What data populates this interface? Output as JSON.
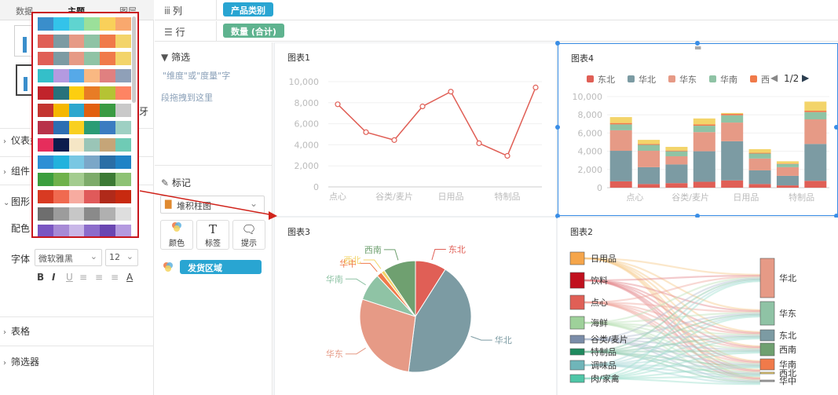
{
  "left_panel": {
    "tabs": [
      "数据",
      "主题",
      "图层"
    ],
    "sections": {
      "dashboard": "仪表盘",
      "component": "组件",
      "graphic": "图形",
      "table": "表格",
      "filter": "筛选器"
    },
    "color_label": "配色",
    "font_label": "字体",
    "font_value": "微软雅黑",
    "size_value": "12",
    "partial_char": "牙",
    "format_buttons": [
      "B",
      "I",
      "U",
      "≡",
      "≡",
      "≡",
      "A"
    ]
  },
  "palettes": [
    [
      "#3a8ecb",
      "#33c3ea",
      "#5fd4d0",
      "#9be09a",
      "#f9d05a",
      "#f9a86e"
    ],
    [
      "#e05f56",
      "#7c9ba3",
      "#e69a86",
      "#8fc3a5",
      "#f07a4a",
      "#f3d46a"
    ],
    [
      "#e05f56",
      "#7c9ba3",
      "#e69a86",
      "#8fc3a5",
      "#f07a4a",
      "#f3d46a"
    ],
    [
      "#34bfc9",
      "#b49ae0",
      "#56a9e8",
      "#f9b882",
      "#e08080",
      "#8fa0b8"
    ],
    [
      "#c1232b",
      "#27727b",
      "#fcce10",
      "#e87c25",
      "#b5c334",
      "#fe8463"
    ],
    [
      "#c33530",
      "#f5b700",
      "#2da7ce",
      "#e2600f",
      "#3a9b43",
      "#c9c9c9"
    ],
    [
      "#b8324a",
      "#2d6eb2",
      "#f9d020",
      "#2a9c75",
      "#3b7cc1",
      "#9ed0c3"
    ],
    [
      "#e62d5c",
      "#0d1c4d",
      "#f5e6c5",
      "#9ac5b7",
      "#c5a578",
      "#6fcbb5"
    ],
    [
      "#2d8fd5",
      "#23b2dd",
      "#79c7e3",
      "#7ba7c8",
      "#2a6ea6",
      "#1f83c6"
    ],
    [
      "#3b9e3e",
      "#6fb24c",
      "#a3cc8f",
      "#7dab6a",
      "#3c7a35",
      "#8dc274"
    ],
    [
      "#d83a22",
      "#f06a50",
      "#f7aba0",
      "#e05a5a",
      "#b02a1a",
      "#c82a10"
    ],
    [
      "#6e6e6e",
      "#9c9c9c",
      "#c7c7c7",
      "#8a8a8a",
      "#b0b0b0",
      "#dedede"
    ],
    [
      "#7a56c2",
      "#a78ad6",
      "#c9b7e8",
      "#8c6ccb",
      "#6a46b2",
      "#b49ae0"
    ]
  ],
  "selected_palette": [
    "#e05f56",
    "#7c9ba3",
    "#e69a86",
    "#8fc3a5",
    "#f07a4a",
    "#f3d46a"
  ],
  "mid_panel": {
    "filter_title": "筛选",
    "filter_hint_1": "\"维度\"或\"度量\"字",
    "filter_hint_2": "段拖拽到这里",
    "mark_title": "标记",
    "chart_type": "堆积柱图",
    "btn_color": "颜色",
    "btn_label": "标签",
    "btn_tooltip": "提示",
    "field_pill": "发货区域"
  },
  "shelves": {
    "column_label": "列",
    "column_pill": "产品类别",
    "row_label": "行",
    "row_pill": "数量 (合计)"
  },
  "charts": {
    "chart1": {
      "title": "图表1"
    },
    "chart2": {
      "title": "图表2"
    },
    "chart3": {
      "title": "图表3"
    },
    "chart4": {
      "title": "图表4",
      "pager": "1/2"
    }
  },
  "chart_data": [
    {
      "type": "line",
      "title": "图表1",
      "x": [
        "点心",
        "谷类/麦片",
        "日用品",
        "特制品"
      ],
      "x_points": 8,
      "values": [
        7850,
        5200,
        4450,
        7650,
        9050,
        4150,
        2950,
        9450
      ],
      "yticks": [
        "0",
        "2,000",
        "4,000",
        "6,000",
        "8,000",
        "10,000"
      ],
      "ylim": [
        0,
        10000
      ],
      "color": "#e05f56"
    },
    {
      "type": "bar",
      "title": "图表4",
      "stacked": true,
      "categories": [
        "点心",
        "谷类/麦片",
        "日用品",
        "特制品"
      ],
      "yticks": [
        "0",
        "2,000",
        "4,000",
        "6,000",
        "8,000",
        "10,000"
      ],
      "ylim": [
        0,
        10000
      ],
      "series": [
        {
          "name": "东北",
          "color": "#e05f56",
          "values": [
            700,
            400,
            500,
            650,
            800,
            400,
            250,
            750
          ]
        },
        {
          "name": "华北",
          "color": "#7c9ba3",
          "values": [
            3350,
            1850,
            2050,
            3350,
            4300,
            1500,
            1050,
            4050
          ]
        },
        {
          "name": "华东",
          "color": "#e69a86",
          "values": [
            2250,
            1800,
            900,
            2100,
            2050,
            1300,
            950,
            2700
          ]
        },
        {
          "name": "华南",
          "color": "#8fc3a5",
          "values": [
            650,
            650,
            550,
            700,
            800,
            550,
            350,
            800
          ]
        },
        {
          "name": "西北",
          "color": "#f07a4a",
          "values": [
            150,
            100,
            80,
            150,
            150,
            80,
            50,
            150
          ]
        },
        {
          "name": "西南",
          "color": "#f3d46a",
          "values": [
            650,
            450,
            400,
            650,
            100,
            400,
            250,
            1000
          ]
        }
      ],
      "legend_visible": [
        "东北",
        "华北",
        "华东",
        "华南",
        "西"
      ]
    },
    {
      "type": "pie",
      "title": "图表3",
      "slices": [
        {
          "name": "东北",
          "value": 9,
          "color": "#e05f56"
        },
        {
          "name": "华北",
          "value": 43,
          "color": "#7c9ba3"
        },
        {
          "name": "华东",
          "value": 28,
          "color": "#e69a86"
        },
        {
          "name": "华南",
          "value": 8,
          "color": "#8fc3a5"
        },
        {
          "name": "华中",
          "value": 1.5,
          "color": "#f07a4a"
        },
        {
          "name": "西北",
          "value": 1,
          "color": "#f3d46a"
        },
        {
          "name": "西南",
          "value": 9.5,
          "color": "#6fa070"
        }
      ]
    },
    {
      "type": "sankey",
      "title": "图表2",
      "sources": [
        {
          "name": "日用品",
          "color": "#f5a54a"
        },
        {
          "name": "饮料",
          "color": "#c1101e"
        },
        {
          "name": "点心",
          "color": "#e05f56"
        },
        {
          "name": "海鲜",
          "color": "#9ed19a"
        },
        {
          "name": "谷类/麦片",
          "color": "#7a8ca8"
        },
        {
          "name": "特制品",
          "color": "#1f8a5e"
        },
        {
          "name": "调味品",
          "color": "#6fb5b9"
        },
        {
          "name": "肉/家禽",
          "color": "#4fc6a7"
        }
      ],
      "targets": [
        {
          "name": "华北",
          "color": "#e69a86"
        },
        {
          "name": "华东",
          "color": "#8fc3a5"
        },
        {
          "name": "东北",
          "color": "#7c9ba3"
        },
        {
          "name": "西南",
          "color": "#6fa070"
        },
        {
          "name": "华南",
          "color": "#f07a4a"
        },
        {
          "name": "西北",
          "color": "#f3d46a"
        },
        {
          "name": "华中",
          "color": "#aaaaaa"
        }
      ]
    }
  ]
}
